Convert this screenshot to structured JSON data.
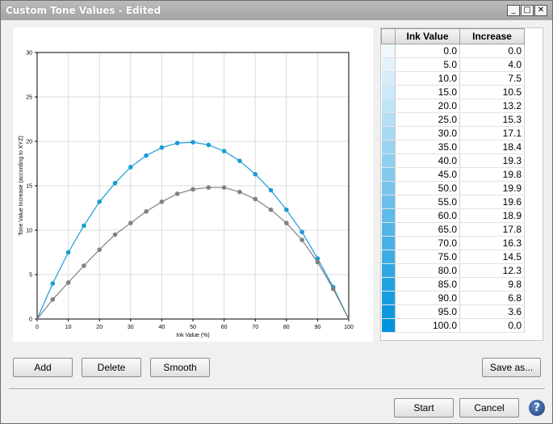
{
  "window": {
    "title": "Custom Tone Values - Edited",
    "controls": {
      "minimize": "_",
      "maximize": "□",
      "close": "✕"
    }
  },
  "chart_data": {
    "type": "line",
    "title": "",
    "xlabel": "Ink Value (%)",
    "ylabel": "Tone Value Increase (according to XYZ)",
    "xlim": [
      0,
      100
    ],
    "ylim": [
      0,
      30
    ],
    "xticks": [
      0,
      10,
      20,
      30,
      40,
      50,
      60,
      70,
      80,
      90,
      100
    ],
    "yticks": [
      0,
      5,
      10,
      15,
      20,
      25,
      30
    ],
    "grid": true,
    "series": [
      {
        "color": "#1a9bd7",
        "x": [
          0,
          5,
          10,
          15,
          20,
          25,
          30,
          35,
          40,
          45,
          50,
          55,
          60,
          65,
          70,
          75,
          80,
          85,
          90,
          95,
          100
        ],
        "values": [
          0.0,
          4.0,
          7.5,
          10.5,
          13.2,
          15.3,
          17.1,
          18.4,
          19.3,
          19.8,
          19.9,
          19.6,
          18.9,
          17.8,
          16.3,
          14.5,
          12.3,
          9.8,
          6.8,
          3.6,
          0.0
        ]
      },
      {
        "color": "#808080",
        "x": [
          0,
          5,
          10,
          15,
          20,
          25,
          30,
          35,
          40,
          45,
          50,
          55,
          60,
          65,
          70,
          75,
          80,
          85,
          90,
          95,
          100
        ],
        "values": [
          0.0,
          2.2,
          4.1,
          6.0,
          7.8,
          9.5,
          10.8,
          12.1,
          13.2,
          14.1,
          14.6,
          14.8,
          14.8,
          14.3,
          13.5,
          12.3,
          10.8,
          8.9,
          6.4,
          3.4,
          0.0
        ]
      }
    ]
  },
  "table": {
    "headers": [
      "Ink Value",
      "Increase"
    ],
    "rows": [
      [
        "0.0",
        "0.0"
      ],
      [
        "5.0",
        "4.0"
      ],
      [
        "10.0",
        "7.5"
      ],
      [
        "15.0",
        "10.5"
      ],
      [
        "20.0",
        "13.2"
      ],
      [
        "25.0",
        "15.3"
      ],
      [
        "30.0",
        "17.1"
      ],
      [
        "35.0",
        "18.4"
      ],
      [
        "40.0",
        "19.3"
      ],
      [
        "45.0",
        "19.8"
      ],
      [
        "50.0",
        "19.9"
      ],
      [
        "55.0",
        "19.6"
      ],
      [
        "60.0",
        "18.9"
      ],
      [
        "65.0",
        "17.8"
      ],
      [
        "70.0",
        "16.3"
      ],
      [
        "75.0",
        "14.5"
      ],
      [
        "80.0",
        "12.3"
      ],
      [
        "85.0",
        "9.8"
      ],
      [
        "90.0",
        "6.8"
      ],
      [
        "95.0",
        "3.6"
      ],
      [
        "100.0",
        "0.0"
      ]
    ],
    "swatch_color": "#0093dd"
  },
  "buttons": {
    "add": "Add",
    "delete": "Delete",
    "smooth": "Smooth",
    "save_as": "Save as...",
    "start": "Start",
    "cancel": "Cancel"
  },
  "help_icon": {
    "name": "help-icon",
    "glyph": "?"
  }
}
